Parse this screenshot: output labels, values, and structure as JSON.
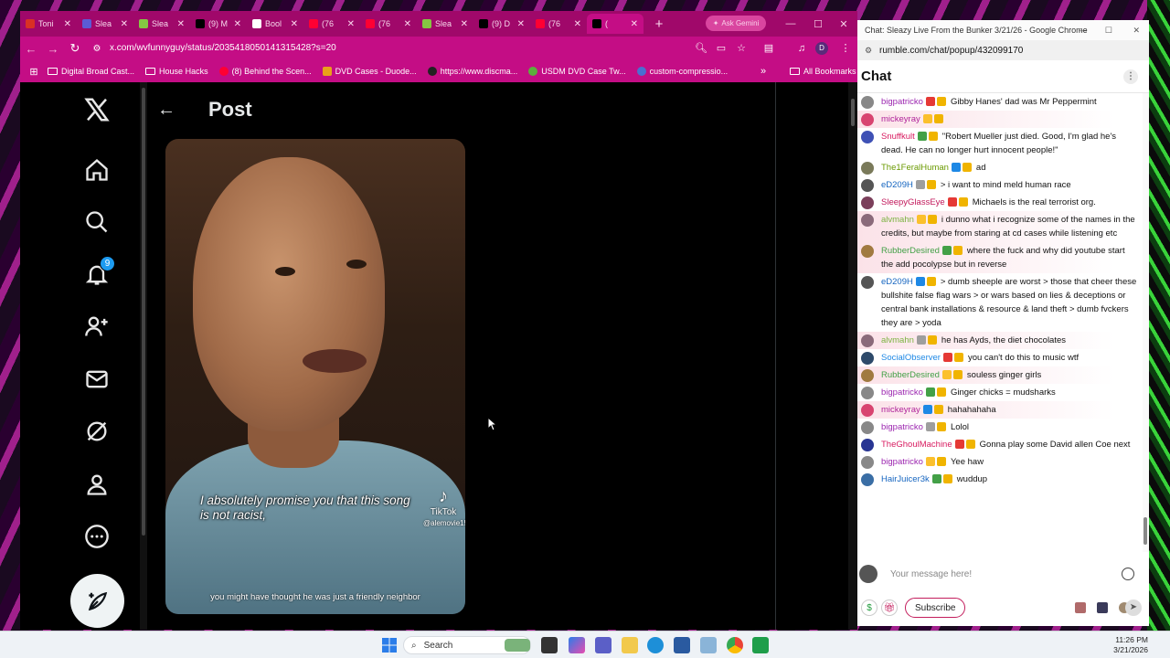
{
  "browser_left": {
    "tabs": [
      {
        "label": "Toni",
        "fav": "gmail-icon",
        "color": "#d93025"
      },
      {
        "label": "Slea",
        "fav": "rumble-icon",
        "color": "#5b5bd6"
      },
      {
        "label": "Slea",
        "fav": "rumble-icon",
        "color": "#85c742"
      },
      {
        "label": "(9) M",
        "fav": "x-icon",
        "color": "#000000"
      },
      {
        "label": "Bool",
        "fav": "star-icon",
        "color": "#ffffff"
      },
      {
        "label": "(76",
        "fav": "youtube-icon",
        "color": "#ff0033"
      },
      {
        "label": "(76",
        "fav": "youtube-icon",
        "color": "#ff0033"
      },
      {
        "label": "Slea",
        "fav": "rumble-icon",
        "color": "#85c742"
      },
      {
        "label": "(9) D",
        "fav": "x-icon",
        "color": "#000000"
      },
      {
        "label": "(76",
        "fav": "youtube-icon",
        "color": "#ff0033"
      },
      {
        "label": "(",
        "fav": "x-icon",
        "color": "#000000"
      }
    ],
    "ai_button": "Ask Gemini",
    "url": "x.com/wvfunnyguy/status/2035418050141315428?s=20",
    "bookmarks": [
      "Digital Broad Cast...",
      "House Hacks",
      "(8) Behind the Scen...",
      "DVD Cases - Duode...",
      "https://www.discma...",
      "USDM DVD Case Tw...",
      "custom-compressio..."
    ],
    "all_bookmarks": "All Bookmarks",
    "profile_initial": "D"
  },
  "x": {
    "notification_count": "9",
    "post_title": "Post",
    "caption": "I absolutely promise you that this song is not racist,",
    "tiktok_label": "TikTok",
    "tiktok_handle": "@alemovie15",
    "subtitle": "you might have thought he was just a friendly neighbor"
  },
  "rumble": {
    "window_title": "Chat: Sleazy Live From the Bunker 3/21/26 - Google Chrome",
    "url": "rumble.com/chat/popup/432099170",
    "chat_title": "Chat",
    "messages": [
      {
        "user": "bigpatricko",
        "color": "#9c27b0",
        "text": "Gibby Hanes' dad was Mr Peppermint",
        "hl": false,
        "av": "#888888"
      },
      {
        "user": "mickeyray",
        "color": "#b0239a",
        "text": "",
        "hl": true,
        "av": "#d84470"
      },
      {
        "user": "Snuffkult",
        "color": "#d81b60",
        "text": "\"Robert Mueller just died. Good, I'm glad he's dead. He can no longer hurt innocent people!\"",
        "hl": false,
        "av": "#3f51b5"
      },
      {
        "user": "The1FeralHuman",
        "color": "#6a9a00",
        "text": "ad",
        "hl": false,
        "av": "#7a7a5a"
      },
      {
        "user": "eD209H",
        "color": "#1565c0",
        "text": "> i want to mind meld human race",
        "hl": false,
        "av": "#555555"
      },
      {
        "user": "SleepyGlassEye",
        "color": "#c2185b",
        "text": "Michaels is the real terrorist org.",
        "hl": false,
        "av": "#7b3f5b"
      },
      {
        "user": "alvmahn",
        "color": "#7cb342",
        "text": "i dunno what i recognize some of the names in the credits, but maybe from staring at cd cases while listening etc",
        "hl": true,
        "av": "#8a6a7a"
      },
      {
        "user": "RubberDesired",
        "color": "#43a047",
        "text": "where the fuck and why did youtube start the add pocolypse but in reverse",
        "hl": true,
        "av": "#a07a40"
      },
      {
        "user": "eD209H",
        "color": "#1565c0",
        "text": "> dumb sheeple are worst > those that cheer these bullshite false flag wars > or wars based on lies & deceptions or central bank installations & resource & land theft > dumb fvckers they are > yoda",
        "hl": false,
        "av": "#555555"
      },
      {
        "user": "alvmahn",
        "color": "#7cb342",
        "text": "he has Ayds, the diet chocolates",
        "hl": true,
        "av": "#8a6a7a"
      },
      {
        "user": "SocialObserver",
        "color": "#1e88e5",
        "text": "you can't do this to music wtf",
        "hl": false,
        "av": "#2d4a6a"
      },
      {
        "user": "RubberDesired",
        "color": "#43a047",
        "text": "souless ginger girls",
        "hl": true,
        "av": "#a07a40"
      },
      {
        "user": "bigpatricko",
        "color": "#9c27b0",
        "text": "Ginger chicks = mudsharks",
        "hl": false,
        "av": "#888888"
      },
      {
        "user": "mickeyray",
        "color": "#b0239a",
        "text": "hahahahaha",
        "hl": true,
        "av": "#d84470"
      },
      {
        "user": "bigpatricko",
        "color": "#9c27b0",
        "text": "Lolol",
        "hl": false,
        "av": "#888888"
      },
      {
        "user": "TheGhoulMachine",
        "color": "#d81b60",
        "text": "Gonna play some David allen Coe next",
        "hl": false,
        "av": "#283593"
      },
      {
        "user": "bigpatricko",
        "color": "#9c27b0",
        "text": "Yee haw",
        "hl": false,
        "av": "#888888"
      },
      {
        "user": "HairJuicer3k",
        "color": "#1565c0",
        "text": "wuddup",
        "hl": false,
        "av": "#3a6ea5"
      }
    ],
    "input_placeholder": "Your message here!",
    "subscribe_label": "Subscribe"
  },
  "taskbar": {
    "search_label": "Search",
    "time": "11:26 PM",
    "date": "3/21/2026"
  }
}
